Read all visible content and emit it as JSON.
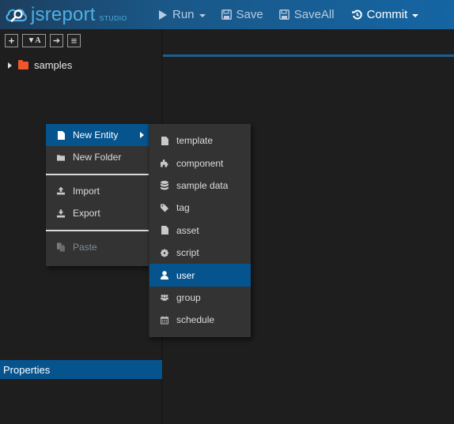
{
  "app": {
    "logo_text": "jsreport",
    "logo_suffix": "STUDIO"
  },
  "toolbar": {
    "run_label": "Run",
    "save_label": "Save",
    "saveall_label": "SaveAll",
    "commit_label": "Commit"
  },
  "tree_tools": {
    "add": "+",
    "filter": "▼A",
    "goto": "➔",
    "menu": "≡"
  },
  "tree": {
    "items": [
      {
        "label": "samples",
        "type": "folder",
        "expanded": false
      }
    ]
  },
  "context_menu": {
    "items": [
      {
        "label": "New Entity",
        "icon": "file-icon",
        "active": true,
        "has_submenu": true
      },
      {
        "label": "New Folder",
        "icon": "folder-icon"
      },
      {
        "label": "Import",
        "icon": "upload-icon"
      },
      {
        "label": "Export",
        "icon": "download-icon"
      },
      {
        "label": "Paste",
        "icon": "paste-icon",
        "disabled": true
      }
    ]
  },
  "submenu": {
    "items": [
      {
        "label": "template",
        "icon": "file-icon"
      },
      {
        "label": "component",
        "icon": "puzzle-icon"
      },
      {
        "label": "sample data",
        "icon": "database-icon"
      },
      {
        "label": "tag",
        "icon": "tag-icon"
      },
      {
        "label": "asset",
        "icon": "file-icon"
      },
      {
        "label": "script",
        "icon": "gear-icon"
      },
      {
        "label": "user",
        "icon": "user-icon",
        "active": true
      },
      {
        "label": "group",
        "icon": "users-icon"
      },
      {
        "label": "schedule",
        "icon": "calendar-icon"
      }
    ]
  },
  "properties": {
    "title": "Properties"
  },
  "colors": {
    "accent": "#05548e",
    "toolbar": "#1565a3",
    "folder": "#f0562a",
    "background": "#1e1e1e",
    "menu": "#333333"
  }
}
